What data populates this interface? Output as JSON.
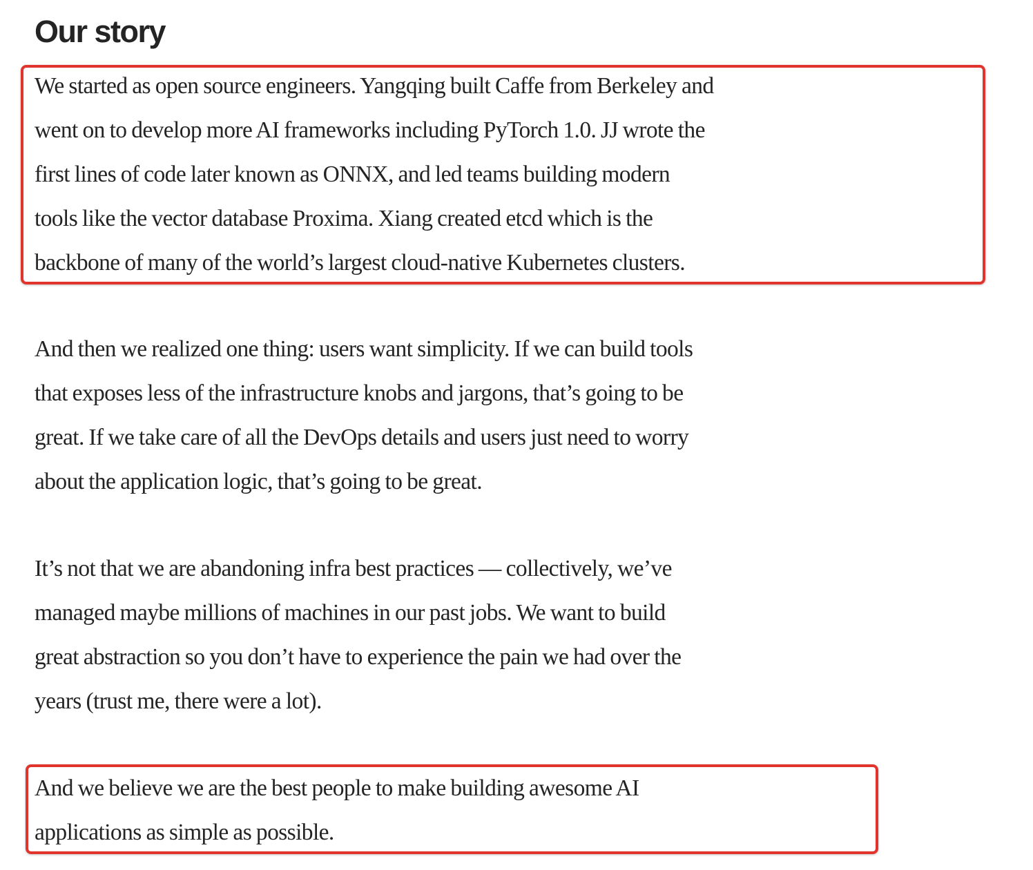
{
  "article": {
    "heading": "Our story",
    "paragraphs": [
      {
        "lines": [
          "We started as open source engineers. Yangqing built Caffe from Berkeley and",
          "went on to develop more AI frameworks including PyTorch 1.0. JJ wrote the",
          "first lines of code later known as ONNX, and led teams building modern",
          "tools like the vector database Proxima. Xiang created etcd which is the",
          "backbone of many of the world’s largest cloud-native Kubernetes clusters."
        ]
      },
      {
        "lines": [
          "And then we realized one thing: users want simplicity. If we can build tools",
          "that exposes less of the infrastructure knobs and jargons, that’s going to be",
          "great. If we take care of all the DevOps details and users just need to worry",
          "about the application logic, that’s going to be great."
        ]
      },
      {
        "lines": [
          "It’s not that we are abandoning infra best practices — collectively, we’ve",
          "managed maybe millions of machines in our past jobs. We want to build",
          "great abstraction so you don’t have to experience the pain we had over the",
          "years (trust me, there were a lot)."
        ]
      },
      {
        "lines": [
          "And we believe we are the best people to make building awesome AI",
          "applications as simple as possible."
        ]
      }
    ]
  },
  "annotations": {
    "highlight_color": "#e0342c"
  }
}
